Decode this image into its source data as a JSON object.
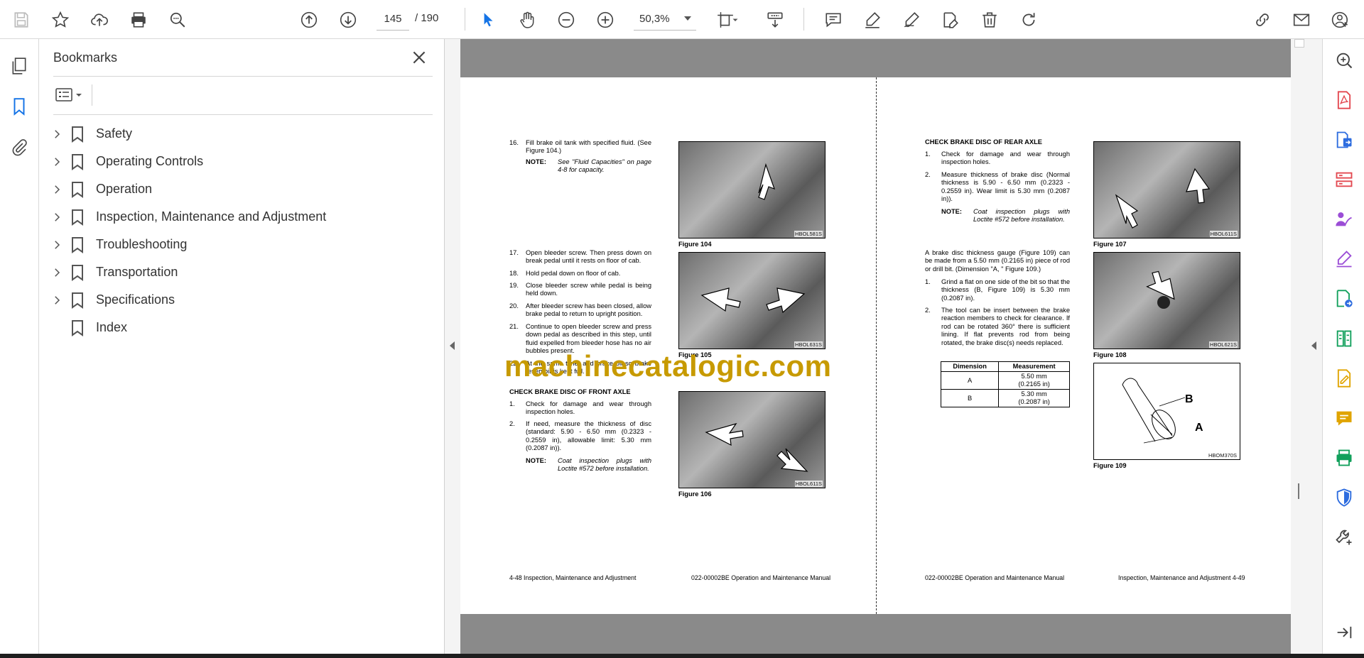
{
  "toolbar": {
    "current_page": "145",
    "total_pages": "/ 190",
    "zoom": "50,3%"
  },
  "bookmarks": {
    "title": "Bookmarks",
    "items": [
      {
        "label": "Safety"
      },
      {
        "label": "Operating Controls"
      },
      {
        "label": "Operation"
      },
      {
        "label": "Inspection, Maintenance and Adjustment"
      },
      {
        "label": "Troubleshooting"
      },
      {
        "label": "Transportation"
      },
      {
        "label": "Specifications"
      },
      {
        "label": "Index"
      }
    ]
  },
  "document": {
    "watermark": "machinecatalogic.com",
    "left_page": {
      "step16": {
        "num": "16.",
        "text": "Fill brake oil tank with specified fluid. (See Figure 104.)"
      },
      "note1": {
        "key": "NOTE:",
        "text": "See \"Fluid Capacities\" on page 4-8 for capacity."
      },
      "step17": {
        "num": "17.",
        "text": "Open bleeder screw. Then press down on break pedal until it rests on floor of cab."
      },
      "step18": {
        "num": "18.",
        "text": "Hold pedal down on floor of cab."
      },
      "step19": {
        "num": "19.",
        "text": "Close bleeder screw while pedal is being held down."
      },
      "step20": {
        "num": "20.",
        "text": "After bleeder screw has been closed, allow brake pedal to return to upright position."
      },
      "step21": {
        "num": "21.",
        "text": "Continue to open bleeder screw and press down pedal as described in this step, until fluid expelled from bleeder hose has no air bubbles present."
      },
      "step22": {
        "num": "22.",
        "text": "At the same time, add brake oil so brake reservoir is kept full."
      },
      "heading_front": "CHECK BRAKE DISC OF FRONT AXLE",
      "front1": {
        "num": "1.",
        "text": "Check for damage and wear through inspection holes."
      },
      "front2": {
        "num": "2.",
        "text": "If need, measure the thickness of disc (standard: 5.90 - 6.50 mm (0.2323 - 0.2559 in), allowable limit: 5.30 mm (0.2087 in))."
      },
      "note2": {
        "key": "NOTE:",
        "text": "Coat inspection plugs with Loctite #572 before installation."
      },
      "fig104": {
        "caption": "Figure 104",
        "code": "HBOL581S"
      },
      "fig105": {
        "caption": "Figure 105",
        "code": "HBOL631S"
      },
      "fig106": {
        "caption": "Figure 106",
        "code": "HBOL611S"
      },
      "footer_left": "4-48  Inspection, Maintenance and Adjustment",
      "footer_right": "022-00002BE Operation and Maintenance Manual"
    },
    "right_page": {
      "heading_rear": "CHECK BRAKE DISC OF REAR AXLE",
      "rear1": {
        "num": "1.",
        "text": "Check for damage and wear through inspection holes."
      },
      "rear2": {
        "num": "2.",
        "text": "Measure thickness of brake disc (Normal thickness is 5.90 - 6.50 mm (0.2323 - 0.2559 in). Wear limit is 5.30 mm (0.2087 in))."
      },
      "note3": {
        "key": "NOTE:",
        "text": "Coat inspection plugs with Loctite #572 before installation."
      },
      "gauge_para": "A brake disc thickness gauge (Figure 109) can be made from a 5.50 mm (0.2165 in) piece of rod or drill bit. (Dimension \"A, \" Figure 109.)",
      "gauge1": {
        "num": "1.",
        "text": "Grind a flat on one side of the bit so that the thickness (B, Figure 109) is 5.30 mm (0.2087 in)."
      },
      "gauge2": {
        "num": "2.",
        "text": "The tool can be insert between the brake reaction members to check for clearance. If rod can be rotated 360° there is sufficient lining. If flat prevents rod from being rotated, the brake disc(s) needs replaced."
      },
      "table": {
        "headers": [
          "Dimension",
          "Measurement"
        ],
        "rows": [
          {
            "dim": "A",
            "m1": "5.50 mm",
            "m2": "(0.2165 in)"
          },
          {
            "dim": "B",
            "m1": "5.30 mm",
            "m2": "(0.2087 in)"
          }
        ]
      },
      "fig107": {
        "caption": "Figure 107",
        "code": "HBOL611S"
      },
      "fig108": {
        "caption": "Figure 108",
        "code": "HBOL621S"
      },
      "fig109": {
        "caption": "Figure 109",
        "code": "HBOM370S",
        "label_a": "A",
        "label_b": "B"
      },
      "footer_left": "022-00002BE Operation and Maintenance Manual",
      "footer_right": "Inspection, Maintenance and Adjustment 4-49"
    }
  },
  "colors": {
    "accent": "#1473e6",
    "watermark": "#c79a00",
    "red_tool": "#e34850",
    "blue_tool": "#2d6cdf",
    "purple_tool": "#9b4dd6",
    "yellow_tool": "#e0a400",
    "green_tool": "#12a05c"
  }
}
